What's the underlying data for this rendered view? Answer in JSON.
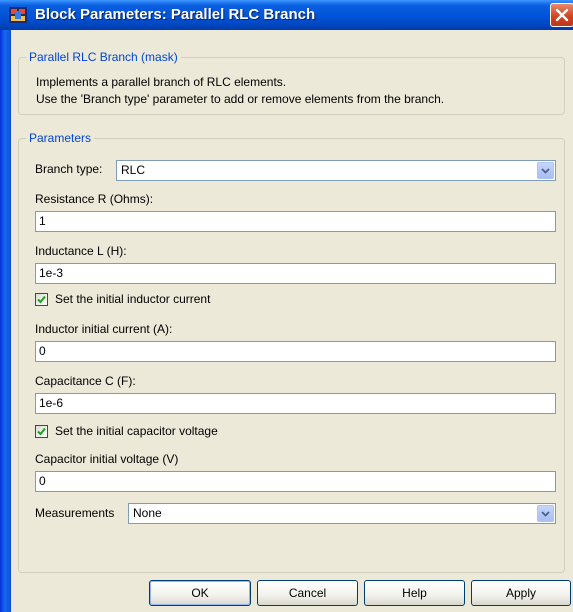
{
  "window": {
    "title": "Block Parameters: Parallel RLC Branch"
  },
  "mask": {
    "group_label": "Parallel RLC Branch (mask)",
    "description_line1": "Implements a parallel branch of RLC elements.",
    "description_line2": "Use the 'Branch type' parameter to add or remove elements from the branch."
  },
  "parameters": {
    "group_label": "Parameters",
    "branch_type_label": "Branch type:",
    "branch_type_value": "RLC",
    "resistance_label": "Resistance R (Ohms):",
    "resistance_value": "1",
    "inductance_label": "Inductance L (H):",
    "inductance_value": "1e-3",
    "set_inductor_current_label": "Set the initial inductor current",
    "set_inductor_current_checked": true,
    "inductor_current_label": "Inductor initial current (A):",
    "inductor_current_value": "0",
    "capacitance_label": "Capacitance C (F):",
    "capacitance_value": "1e-6",
    "set_capacitor_voltage_label": "Set the initial capacitor voltage",
    "set_capacitor_voltage_checked": true,
    "capacitor_voltage_label": "Capacitor initial voltage (V)",
    "capacitor_voltage_value": "0",
    "measurements_label": "Measurements",
    "measurements_value": "None"
  },
  "buttons": {
    "ok": "OK",
    "cancel": "Cancel",
    "help": "Help",
    "apply": "Apply"
  },
  "colors": {
    "titlebar": "#0053d6",
    "group_label": "#0046d5",
    "dialog_bg": "#ece9d8"
  }
}
